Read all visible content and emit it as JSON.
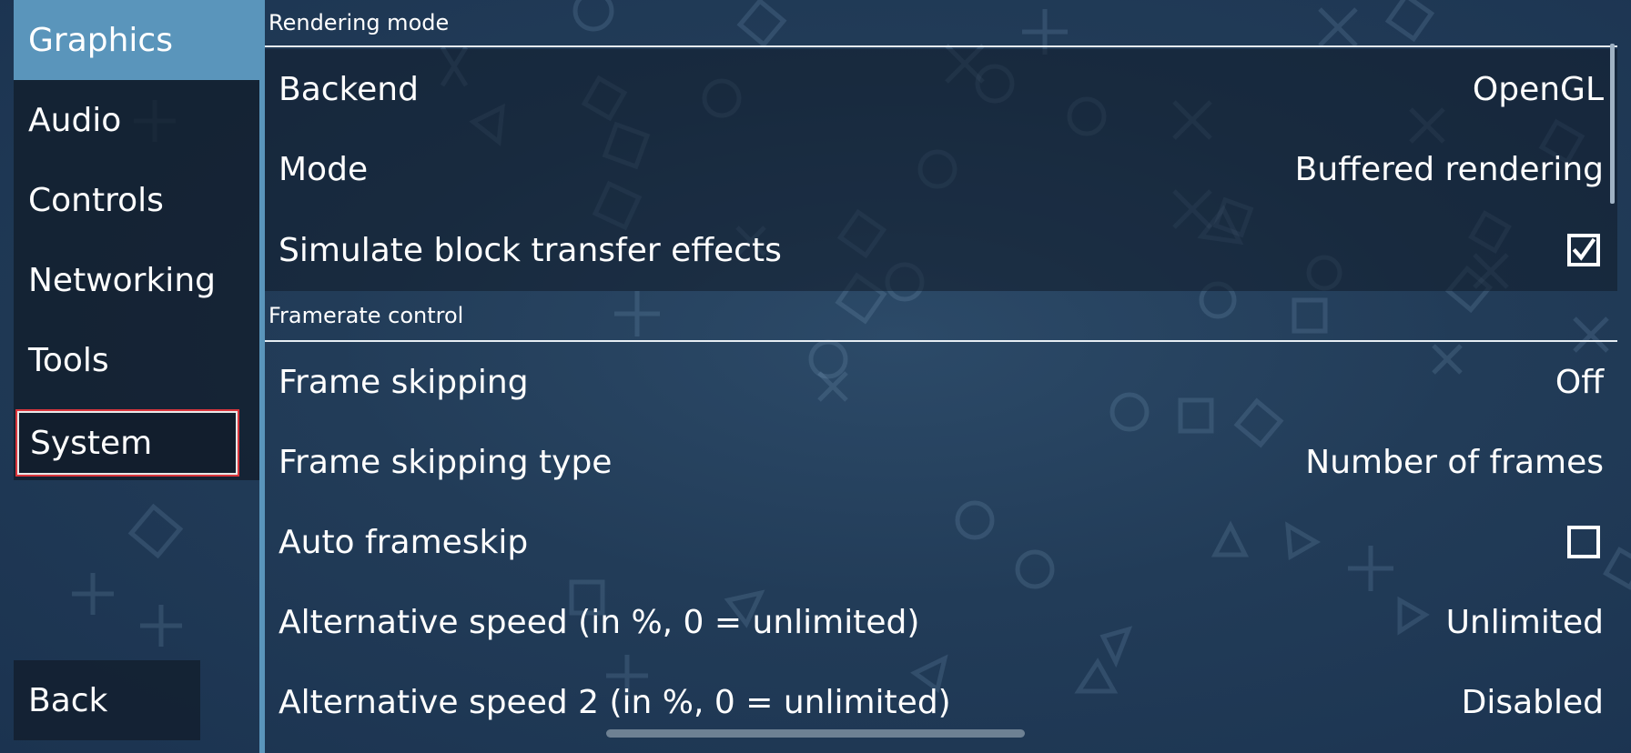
{
  "sidebar": {
    "items": [
      {
        "label": "Graphics"
      },
      {
        "label": "Audio"
      },
      {
        "label": "Controls"
      },
      {
        "label": "Networking"
      },
      {
        "label": "Tools"
      },
      {
        "label": "System"
      }
    ],
    "back_label": "Back"
  },
  "sections": [
    {
      "title": "Rendering mode",
      "rows": [
        {
          "label": "Backend",
          "value": "OpenGL"
        },
        {
          "label": "Mode",
          "value": "Buffered rendering"
        },
        {
          "label": "Simulate block transfer effects",
          "checked": true
        }
      ]
    },
    {
      "title": "Framerate control",
      "rows": [
        {
          "label": "Frame skipping",
          "value": "Off"
        },
        {
          "label": "Frame skipping type",
          "value": "Number of frames"
        },
        {
          "label": "Auto frameskip",
          "checked": false
        },
        {
          "label": "Alternative speed (in %, 0 = unlimited)",
          "value": "Unlimited"
        },
        {
          "label": "Alternative speed 2 (in %, 0 = unlimited)",
          "value": "Disabled"
        }
      ]
    }
  ],
  "colors": {
    "background": "#223c58",
    "selected_tab": "#5a95bb",
    "focus_border": "#d9343b"
  },
  "icons": [
    "checkmark-icon",
    "checkbox-icon"
  ]
}
